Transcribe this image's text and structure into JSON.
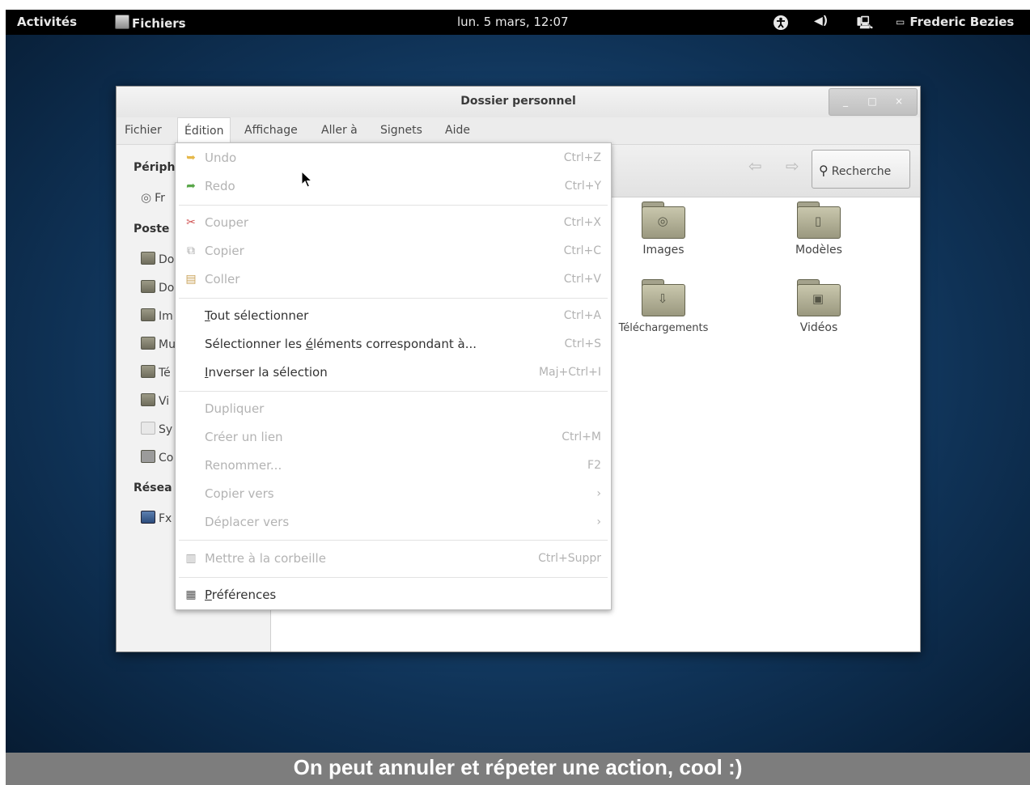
{
  "topbar": {
    "activities": "Activités",
    "app_menu": "Fichiers",
    "clock": "lun. 5 mars, 12:07",
    "tray_volume": "◀)",
    "tray_network": "🖳",
    "user": "Frederic Bezies",
    "icons": [
      "accessibility-icon",
      "volume-icon",
      "network-icon",
      "chat-icon"
    ]
  },
  "window": {
    "title": "Dossier personnel",
    "controls": {
      "minimize": "_",
      "maximize": "□",
      "close": "×"
    }
  },
  "menubar": {
    "items": [
      "Fichier",
      "Édition",
      "Affichage",
      "Aller à",
      "Signets",
      "Aide"
    ],
    "active": "Édition"
  },
  "sidebar": {
    "sections": [
      {
        "heading": "Périph",
        "items": [
          "Fr"
        ]
      },
      {
        "heading": "Poste",
        "items": [
          "Do",
          "Do",
          "Im",
          "Mu",
          "Té",
          "Vi",
          "Sy",
          "Co"
        ]
      },
      {
        "heading": "Résea",
        "items": [
          "Fx"
        ]
      }
    ]
  },
  "toolbar": {
    "back": "⇦",
    "forward": "⇨",
    "search_label": "Recherche"
  },
  "files": [
    {
      "label": "Images",
      "icon": "camera-icon"
    },
    {
      "label": "Modèles",
      "icon": "document-icon"
    },
    {
      "label": "Téléchargements",
      "icon": "download-icon"
    },
    {
      "label": "Vidéos",
      "icon": "film-icon"
    }
  ],
  "edit_menu": {
    "undo": {
      "label": "Undo",
      "accel": "Ctrl+Z"
    },
    "redo": {
      "label": "Redo",
      "accel": "Ctrl+Y"
    },
    "cut": {
      "label": "Couper",
      "accel": "Ctrl+X"
    },
    "copy": {
      "label": "Copier",
      "accel": "Ctrl+C"
    },
    "paste": {
      "label": "Coller",
      "accel": "Ctrl+V"
    },
    "select_all": {
      "label_mnemonic": "T",
      "label_rest": "out sélectionner",
      "accel": "Ctrl+A"
    },
    "select_matching": {
      "label_pre": "Sélectionner les ",
      "label_mnemonic": "é",
      "label_rest": "léments correspondant à...",
      "accel": "Ctrl+S"
    },
    "invert": {
      "label_mnemonic": "I",
      "label_rest": "nverser la sélection",
      "accel": "Maj+Ctrl+I"
    },
    "duplicate": {
      "label": "Dupliquer",
      "accel": ""
    },
    "create_link": {
      "label": "Créer un lien",
      "accel": "Ctrl+M"
    },
    "rename": {
      "label": "Renommer...",
      "accel": "F2"
    },
    "copy_to": {
      "label": "Copier vers",
      "accel": "›"
    },
    "move_to": {
      "label": "Déplacer vers",
      "accel": "›"
    },
    "trash": {
      "label": "Mettre à la corbeille",
      "accel": "Ctrl+Suppr"
    },
    "preferences": {
      "label_mnemonic": "P",
      "label_rest": "références"
    }
  },
  "caption": "On peut annuler et répeter une action, cool :)"
}
